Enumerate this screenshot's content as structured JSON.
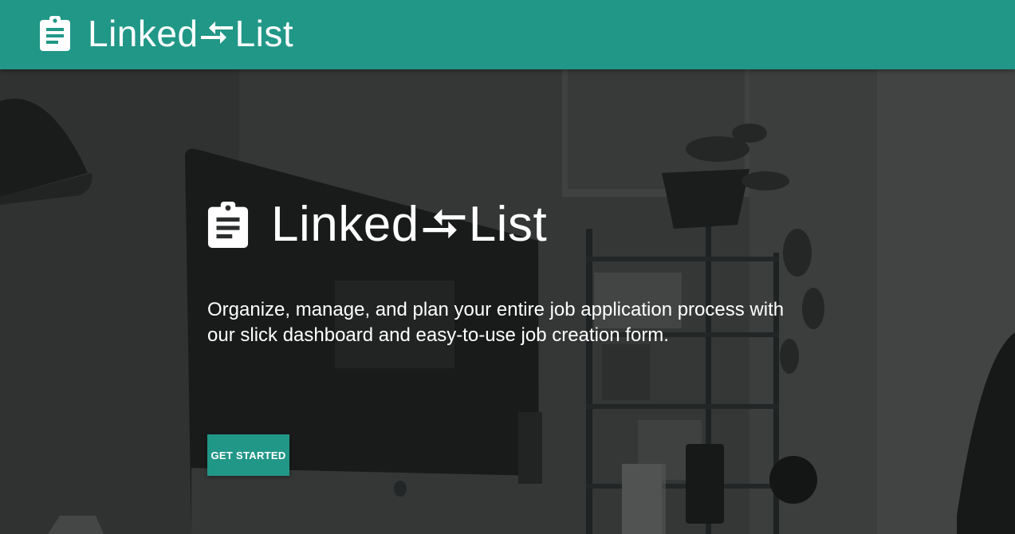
{
  "colors": {
    "primary": "#219787",
    "text": "#ffffff"
  },
  "header": {
    "logo_icon": "assignment-clipboard-icon",
    "arrows_icon": "compare-arrows-icon",
    "brand_left": "Linked",
    "brand_right": "List"
  },
  "hero": {
    "logo_icon": "assignment-clipboard-icon",
    "arrows_icon": "compare-arrows-icon",
    "brand_left": "Linked",
    "brand_right": "List",
    "tagline": "Organize, manage, and plan your entire job application process with our slick dashboard and easy-to-use job creation form.",
    "cta_label": "GET STARTED",
    "background_image": "desk-workspace-photo"
  }
}
